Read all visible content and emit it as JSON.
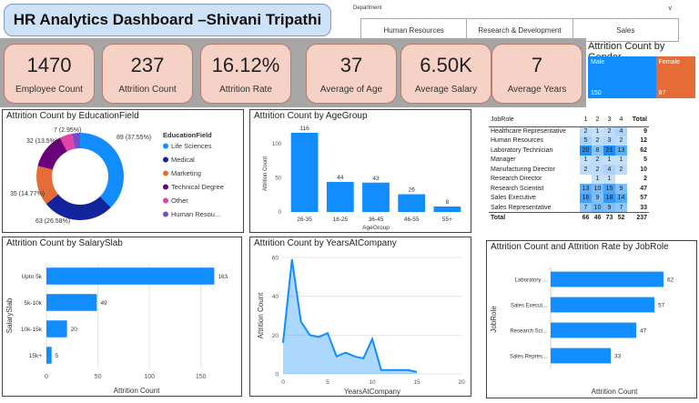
{
  "title": "HR Analytics Dashboard –Shivani Tripathi",
  "department_slicer": {
    "label": "Department",
    "chevron": "v",
    "options": [
      "Human Resources",
      "Research & Development",
      "Sales"
    ]
  },
  "kpis": [
    {
      "value": "1470",
      "label": "Employee Count"
    },
    {
      "value": "237",
      "label": "Attrition Count"
    },
    {
      "value": "16.12%",
      "label": "Attrition Rate"
    },
    {
      "value": "37",
      "label": "Average of Age"
    },
    {
      "value": "6.50K",
      "label": "Average Salary"
    },
    {
      "value": "7",
      "label": "Average Years"
    }
  ],
  "gender": {
    "title": "Attrition Count by Gender",
    "segments": [
      {
        "label": "Male",
        "value": "150",
        "color": "#118dff"
      },
      {
        "label": "Female",
        "value": "87",
        "color": "#e66c37"
      }
    ]
  },
  "panels": {
    "education": "Attrition Count by EducationField",
    "agegroup": "Attrition Count by AgeGroup",
    "salaryslab": "Attrition Count by SalarySlab",
    "years": "Attrition Count by YearsAtCompany",
    "jobrole": "Attrition Count and Attrition Rate by JobRole"
  },
  "matrix": {
    "header_label": "JobRole",
    "columns": [
      "1",
      "2",
      "3",
      "4",
      "Total"
    ],
    "rows": [
      {
        "role": "Healthcare Representative",
        "cells": [
          "2",
          "1",
          "2",
          "4"
        ],
        "total": "9"
      },
      {
        "role": "Human Resources",
        "cells": [
          "5",
          "2",
          "3",
          "2"
        ],
        "total": "12"
      },
      {
        "role": "Laboratory Technician",
        "cells": [
          "20",
          "8",
          "21",
          "13"
        ],
        "total": "62"
      },
      {
        "role": "Manager",
        "cells": [
          "1",
          "2",
          "1",
          "1"
        ],
        "total": "5"
      },
      {
        "role": "Manufacturing Director",
        "cells": [
          "2",
          "2",
          "4",
          "2"
        ],
        "total": "10"
      },
      {
        "role": "Research Director",
        "cells": [
          "",
          "1",
          "1",
          ""
        ],
        "total": "2"
      },
      {
        "role": "Research Scientist",
        "cells": [
          "13",
          "10",
          "15",
          "9"
        ],
        "total": "47"
      },
      {
        "role": "Sales Executive",
        "cells": [
          "16",
          "9",
          "18",
          "14"
        ],
        "total": "57"
      },
      {
        "role": "Sales Representative",
        "cells": [
          "7",
          "10",
          "9",
          "7"
        ],
        "total": "33"
      }
    ],
    "total_row": {
      "role": "Total",
      "cells": [
        "66",
        "46",
        "73",
        "52"
      ],
      "total": "237"
    }
  },
  "chart_data": [
    {
      "type": "pie",
      "title": "Attrition Count by EducationField",
      "legend_title": "EducationField",
      "legend_position": "right",
      "categories": [
        "Life Sciences",
        "Medical",
        "Marketing",
        "Technical Degree",
        "Other",
        "Human Resou..."
      ],
      "values": [
        89,
        63,
        35,
        32,
        11,
        7
      ],
      "colors": [
        "#118dff",
        "#12239e",
        "#e66c37",
        "#6b007b",
        "#e044a7",
        "#744ec2"
      ],
      "data_labels": [
        "89 (37.55%)",
        "63 (26.58%)",
        "35 (14.77%)",
        "32 (13.5%)",
        "",
        "7 (2.95%)"
      ]
    },
    {
      "type": "bar",
      "title": "Attrition Count by AgeGroup",
      "categories": [
        "26-35",
        "18-25",
        "36-45",
        "46-55",
        "55+"
      ],
      "values": [
        116,
        44,
        43,
        26,
        8
      ],
      "xlabel": "AgeGroup",
      "ylabel": "Attrition Count",
      "ylim": [
        0,
        120
      ],
      "yticks": [
        0,
        50,
        100
      ],
      "color": "#118dff"
    },
    {
      "type": "bar",
      "orientation": "horizontal",
      "title": "Attrition Count by SalarySlab",
      "categories": [
        "Upto 5k",
        "5k-10k",
        "10k-15k",
        "15k+"
      ],
      "values": [
        163,
        49,
        20,
        5
      ],
      "xlabel": "Attrition Count",
      "ylabel": "SalarySlab",
      "xlim": [
        0,
        175
      ],
      "xticks": [
        0,
        50,
        100,
        150
      ],
      "color": "#118dff"
    },
    {
      "type": "area",
      "title": "Attrition Count by YearsAtCompany",
      "x": [
        0,
        1,
        2,
        3,
        4,
        5,
        6,
        7,
        8,
        9,
        10,
        11,
        12,
        13,
        14,
        15
      ],
      "y": [
        16,
        59,
        27,
        20,
        19,
        21,
        9,
        11,
        9,
        8,
        18,
        2,
        2,
        2,
        2,
        1
      ],
      "xlabel": "YearsAtCompany",
      "ylabel": "Attrition Count",
      "xlim": [
        0,
        20
      ],
      "ylim": [
        0,
        60
      ],
      "xticks": [
        0,
        5,
        10,
        15,
        20
      ],
      "yticks": [
        0,
        20,
        40,
        60
      ],
      "color": "#118dff"
    },
    {
      "type": "bar",
      "orientation": "horizontal",
      "title": "Attrition Count and Attrition Rate by JobRole",
      "categories": [
        "Laboratory ...",
        "Sales Execut...",
        "Research Sci...",
        "Sales Repres..."
      ],
      "values": [
        62,
        57,
        47,
        33
      ],
      "xlabel": "Attrition Count",
      "ylabel": "JobRole",
      "xlim": [
        0,
        70
      ],
      "color": "#118dff"
    }
  ]
}
